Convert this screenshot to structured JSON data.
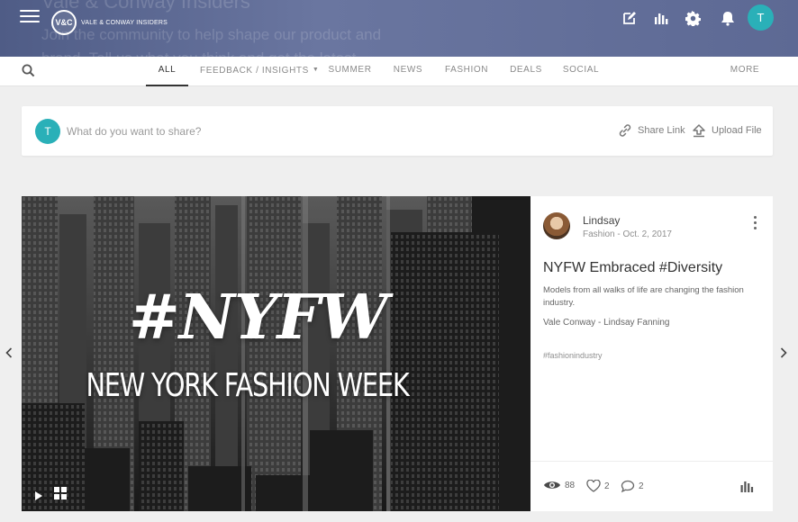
{
  "header": {
    "ghost_title": "Vale & Conway Insiders",
    "ghost_line1": "Join the community to help shape our product and",
    "ghost_line2": "brand. Tell us what you think and get the latest",
    "logo_badge": "V&C",
    "logo_text": "VALE & CONWAY INSIDERS",
    "user_initial": "T"
  },
  "nav": {
    "tabs": [
      {
        "label": "ALL",
        "active": true
      },
      {
        "label": "FEEDBACK / INSIGHTS",
        "dropdown": true
      },
      {
        "label": "SUMMER"
      },
      {
        "label": "NEWS"
      },
      {
        "label": "FASHION"
      },
      {
        "label": "DEALS"
      },
      {
        "label": "SOCIAL"
      },
      {
        "label": "MORE"
      }
    ]
  },
  "share": {
    "avatar_initial": "T",
    "placeholder": "What do you want to share?",
    "share_link_label": "Share Link",
    "upload_file_label": "Upload File"
  },
  "post": {
    "media": {
      "hashtag": "#NYFW",
      "subtitle": "NEW YORK FASHION WEEK"
    },
    "author": "Lindsay",
    "category": "Fashion",
    "date": "Oct. 2, 2017",
    "meta": "Fashion - Oct. 2, 2017",
    "title": "NYFW Embraced #Diversity",
    "description": "Models from all walks of life are changing the fashion industry.",
    "credit": "Vale Conway - Lindsay Fanning",
    "tag": "#fashionindustry",
    "stats": {
      "views": "88",
      "likes": "2",
      "comments": "2"
    }
  },
  "colors": {
    "header_bg": "#5d6a91",
    "accent_teal": "#2ab0b8",
    "page_bg": "#efefef"
  },
  "icons": [
    "menu-icon",
    "edit-icon",
    "bar-chart-icon",
    "gear-icon",
    "bell-icon",
    "search-icon",
    "link-icon",
    "upload-icon",
    "play-icon",
    "gallery-icon",
    "kebab-icon",
    "eye-icon",
    "heart-icon",
    "comment-icon",
    "chevron-left-icon",
    "chevron-right-icon"
  ]
}
